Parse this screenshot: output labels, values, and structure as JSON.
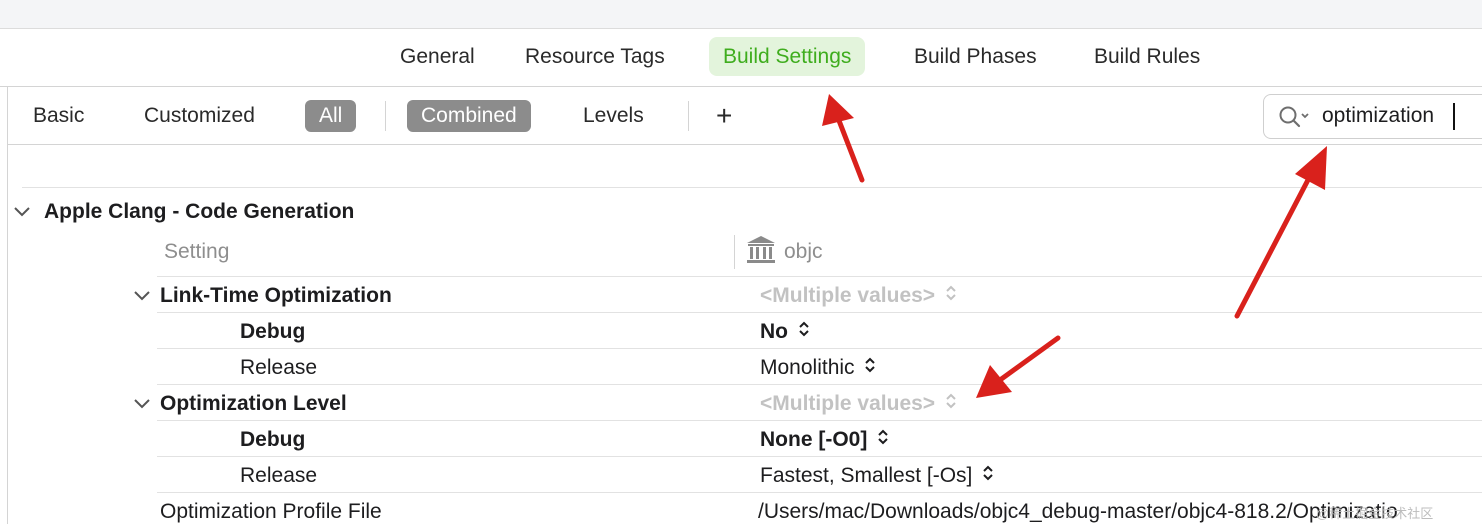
{
  "tabs": {
    "general": "General",
    "resource_tags": "Resource Tags",
    "build_settings": "Build Settings",
    "build_phases": "Build Phases",
    "build_rules": "Build Rules"
  },
  "filters": {
    "basic": "Basic",
    "customized": "Customized",
    "all": "All",
    "combined": "Combined",
    "levels": "Levels",
    "add": "+"
  },
  "search": {
    "value": "optimization"
  },
  "section": {
    "title": "Apple Clang - Code Generation",
    "setting_header": "Setting",
    "target_header": "objc",
    "rows": [
      {
        "name": "Link-Time Optimization",
        "value": "<Multiple values>"
      },
      {
        "name": "Debug",
        "value": "No"
      },
      {
        "name": "Release",
        "value": "Monolithic"
      },
      {
        "name": "Optimization Level",
        "value": "<Multiple values>"
      },
      {
        "name": "Debug",
        "value": "None [-O0]"
      },
      {
        "name": "Release",
        "value": "Fastest, Smallest [-Os]"
      },
      {
        "name": "Optimization Profile File",
        "value": "/Users/mac/Downloads/objc4_debug-master/objc4-818.2/Optimizatio"
      }
    ]
  },
  "watermark": "@稀土掘金技术社区",
  "colors": {
    "active_tab_bg": "#e3f4dc",
    "active_tab_text": "#3fad1e",
    "selected_filter_bg": "#8c8c8c",
    "annotation_arrow": "#d9211c"
  },
  "icons": {
    "search": "magnifier-with-dropdown",
    "target": "institution-building",
    "disclosure": "chevron-down",
    "stepper": "up-down-chevrons"
  }
}
